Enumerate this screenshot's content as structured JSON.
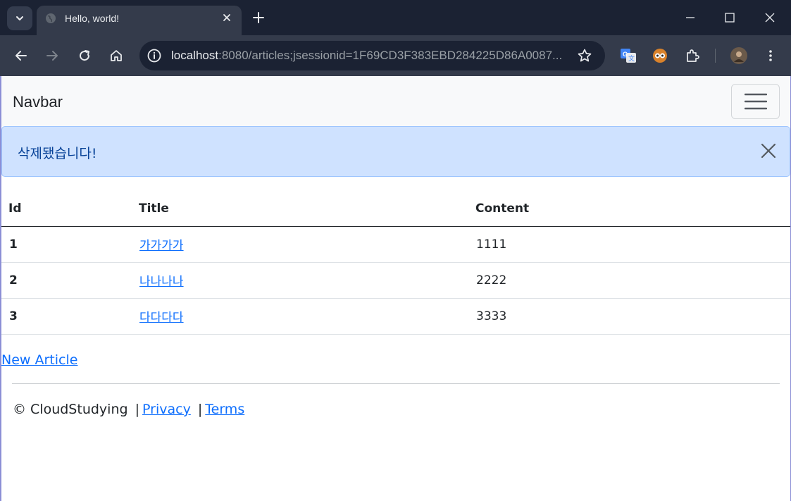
{
  "browser": {
    "tab_title": "Hello, world!",
    "url_host": "localhost",
    "url_rest": ":8080/articles;jsessionid=1F69CD3F383EBD284225D86A0087..."
  },
  "navbar": {
    "brand": "Navbar"
  },
  "alert": {
    "message": "삭제됐습니다!"
  },
  "table": {
    "headers": [
      "Id",
      "Title",
      "Content"
    ],
    "rows": [
      {
        "id": "1",
        "title": "가가가가",
        "content": "1111"
      },
      {
        "id": "2",
        "title": "나나나나",
        "content": "2222"
      },
      {
        "id": "3",
        "title": "다다다다",
        "content": "3333"
      }
    ]
  },
  "new_article_link": "New Article",
  "footer": {
    "copyright": "© CloudStudying",
    "sep": "|",
    "privacy": "Privacy",
    "terms": "Terms"
  },
  "colors": {
    "chrome_dark": "#1b2233",
    "chrome_mid": "#343b4b",
    "alert_bg": "#cfe2ff",
    "alert_text": "#084298",
    "link": "#0d6efd"
  }
}
